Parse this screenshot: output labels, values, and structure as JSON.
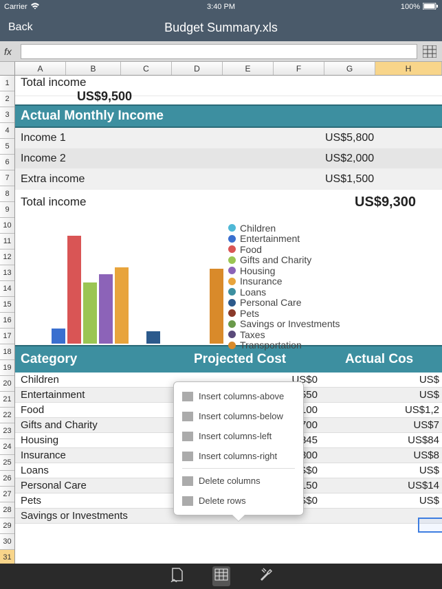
{
  "status": {
    "carrier": "Carrier",
    "time": "3:40 PM",
    "battery": "100%"
  },
  "header": {
    "back": "Back",
    "title": "Budget Summary.xls"
  },
  "formula": {
    "fx": "fx",
    "value": ""
  },
  "columns": [
    "A",
    "B",
    "C",
    "D",
    "E",
    "F",
    "G",
    "H"
  ],
  "rows": [
    "1",
    "2",
    "3",
    "4",
    "5",
    "6",
    "7",
    "8",
    "9",
    "10",
    "11",
    "12",
    "13",
    "14",
    "15",
    "16",
    "17",
    "18",
    "19",
    "20",
    "21",
    "22",
    "23",
    "24",
    "25",
    "26",
    "27",
    "28",
    "29",
    "30",
    "31"
  ],
  "sheet": {
    "total_income_top": {
      "label": "Total income",
      "value": "US$9,500"
    },
    "section_actual": "Actual Monthly Income",
    "income_rows": [
      {
        "label": "Income 1",
        "value": "US$5,800"
      },
      {
        "label": "Income 2",
        "value": "US$2,000"
      },
      {
        "label": "Extra income",
        "value": "US$1,500"
      }
    ],
    "total_income_bottom": {
      "label": "Total income",
      "value": "US$9,300"
    },
    "category_header": {
      "c1": "Category",
      "c2": "Projected Cost",
      "c3": "Actual Cos"
    },
    "categories": [
      {
        "c1": "Children",
        "c2": "US$0",
        "c3": "US$"
      },
      {
        "c1": "Entertainment",
        "c2": "US$550",
        "c3": "US$"
      },
      {
        "c1": "Food",
        "c2": "US$1,100",
        "c3": "US$1,2"
      },
      {
        "c1": "Gifts and Charity",
        "c2": "US$700",
        "c3": "US$7"
      },
      {
        "c1": "Housing",
        "c2": "US$845",
        "c3": "US$84"
      },
      {
        "c1": "Insurance",
        "c2": "US$800",
        "c3": "US$8"
      },
      {
        "c1": "Loans",
        "c2": "US$0",
        "c3": "US$"
      },
      {
        "c1": "Personal Care",
        "c2": "US$150",
        "c3": "US$14"
      },
      {
        "c1": "Pets",
        "c2": "US$0",
        "c3": "US$"
      },
      {
        "c1": "Savings or Investments",
        "c2": "",
        "c3": ""
      }
    ]
  },
  "legend": [
    {
      "label": "Children",
      "color": "#4fb8d6"
    },
    {
      "label": "Entertainment",
      "color": "#3a6fcf"
    },
    {
      "label": "Food",
      "color": "#d95555"
    },
    {
      "label": "Gifts and Charity",
      "color": "#9bc553"
    },
    {
      "label": "Housing",
      "color": "#8c63b8"
    },
    {
      "label": "Insurance",
      "color": "#e8a43c"
    },
    {
      "label": "Loans",
      "color": "#3d8fa0"
    },
    {
      "label": "Personal Care",
      "color": "#2c5a8c"
    },
    {
      "label": "Pets",
      "color": "#8a3a2a"
    },
    {
      "label": "Savings or Investments",
      "color": "#6a9a4a"
    },
    {
      "label": "Taxes",
      "color": "#5a4a7a"
    },
    {
      "label": "Transportation",
      "color": "#d98a2a"
    }
  ],
  "popover": {
    "items": [
      "Insert columns-above",
      "Insert columns-below",
      "Insert columns-left",
      "Insert columns-right"
    ],
    "items2": [
      "Delete columns",
      "Delete rows"
    ]
  },
  "chart_data": {
    "type": "bar",
    "categories": [
      "Children",
      "Entertainment",
      "Food",
      "Gifts and Charity",
      "Housing",
      "Insurance",
      "Loans",
      "Personal Care",
      "Pets",
      "Savings or Investments",
      "Taxes",
      "Transportation"
    ],
    "values": [
      0,
      170,
      1200,
      680,
      770,
      850,
      0,
      140,
      0,
      0,
      0,
      830
    ],
    "colors": [
      "#4fb8d6",
      "#3a6fcf",
      "#d95555",
      "#9bc553",
      "#8c63b8",
      "#e8a43c",
      "#3d8fa0",
      "#2c5a8c",
      "#8a3a2a",
      "#6a9a4a",
      "#5a4a7a",
      "#d98a2a"
    ],
    "title": "",
    "xlabel": "",
    "ylabel": "",
    "ylim": [
      0,
      1300
    ]
  }
}
